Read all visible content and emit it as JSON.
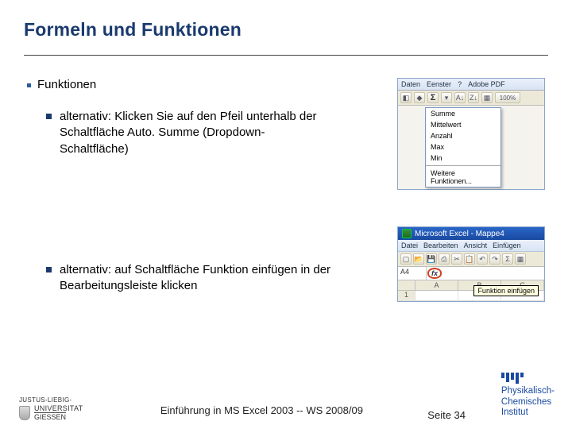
{
  "title": "Formeln und Funktionen",
  "bullets": {
    "lvl1": "Funktionen",
    "alt1": "alternativ: Klicken Sie auf den Pfeil unterhalb der Schaltfläche Auto. Summe (Dropdown-Schaltfläche)",
    "alt2": "alternativ: auf Schaltfläche Funktion einfügen in der Bearbeitungsleiste klicken"
  },
  "screenshot1": {
    "menubar": {
      "daten": "Daten",
      "fenster": "Eenster",
      "hilfe": "?",
      "adobe": "Adobe PDF"
    },
    "sigma": "Σ",
    "dropdown": {
      "summe": "Summe",
      "mittelwert": "Mittelwert",
      "anzahl": "Anzahl",
      "max": "Max",
      "min": "Min",
      "weitere": "Weitere Funktionen..."
    }
  },
  "screenshot2": {
    "title": "Microsoft Excel - Mappe4",
    "menubar": {
      "datei": "Datei",
      "bearb": "Bearbeiten",
      "ansicht": "Ansicht",
      "einf": "Einfügen"
    },
    "cellref": "A4",
    "fx": "fx",
    "cols": {
      "a": "A",
      "b": "B",
      "c": "C"
    },
    "row1": "1",
    "tooltip": "Funktion einfügen"
  },
  "footer": {
    "jl": "JUSTUS-LIEBIG-",
    "uni": "UNIVERSITAT",
    "giessen": "GIESSEN",
    "center": "Einführung in MS Excel 2003  --  WS 2008/09",
    "page": "Seite 34",
    "inst1": "Physikalisch-",
    "inst2": "Chemisches",
    "inst3": "Institut"
  }
}
